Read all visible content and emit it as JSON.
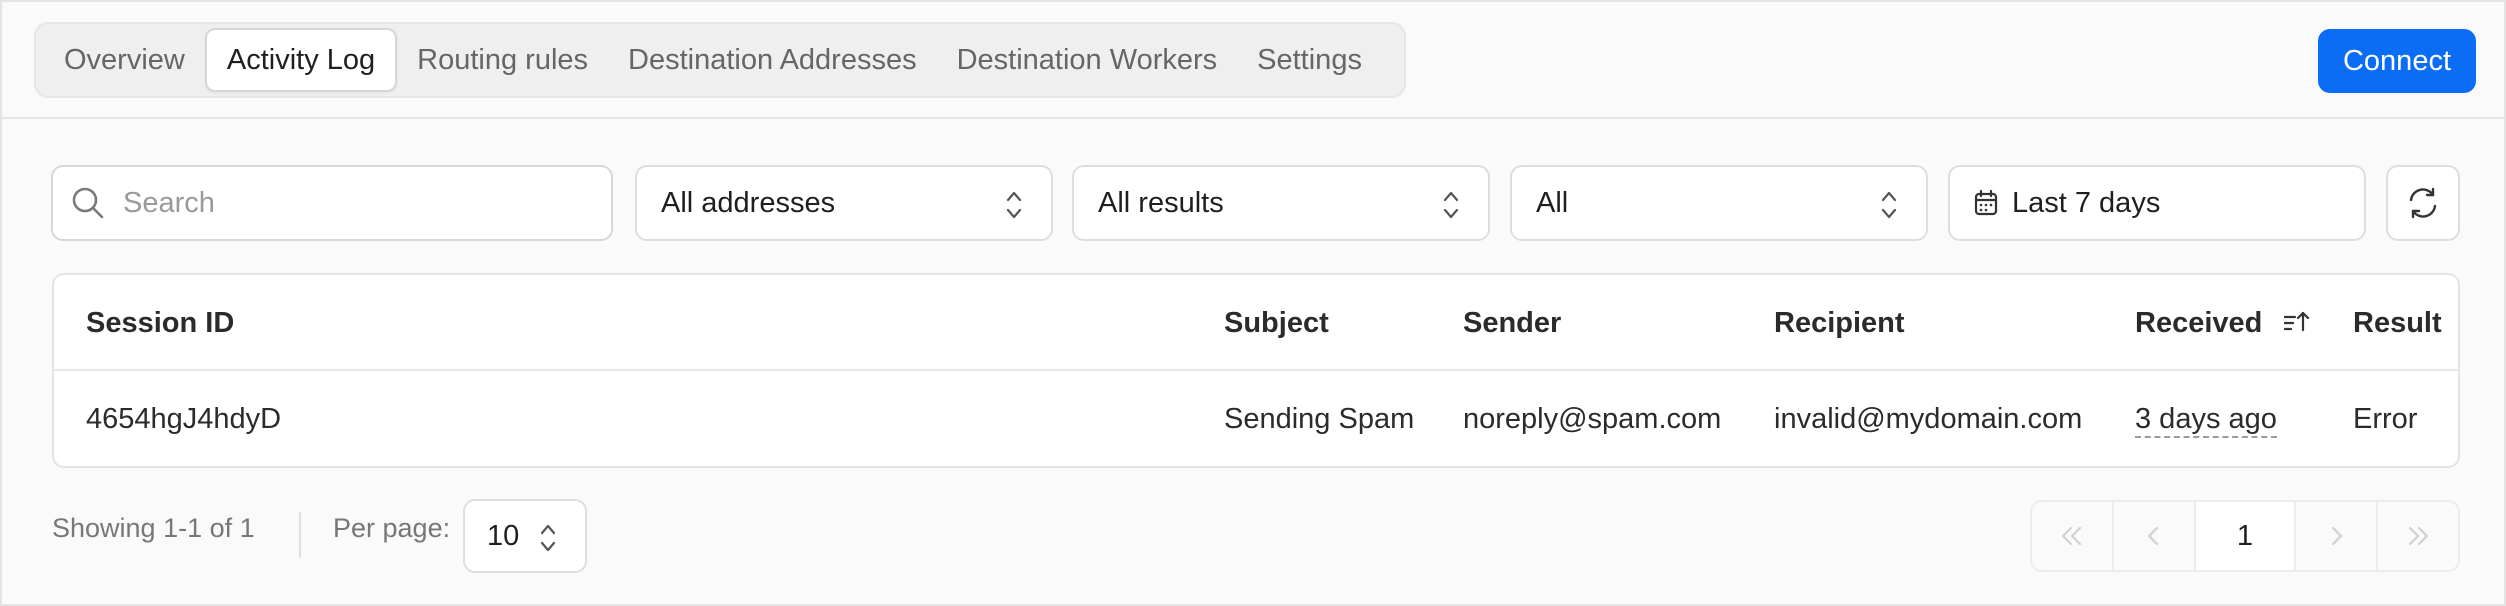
{
  "tabs": [
    {
      "label": "Overview"
    },
    {
      "label": "Activity Log"
    },
    {
      "label": "Routing rules"
    },
    {
      "label": "Destination Addresses"
    },
    {
      "label": "Destination Workers"
    },
    {
      "label": "Settings"
    }
  ],
  "active_tab": "Activity Log",
  "connect_label": "Connect",
  "filters": {
    "search_placeholder": "Search",
    "search_value": "",
    "addresses": "All addresses",
    "results": "All results",
    "type": "All",
    "date_range": "Last 7 days"
  },
  "table": {
    "columns": [
      "Session ID",
      "Subject",
      "Sender",
      "Recipient",
      "Received",
      "Result"
    ],
    "rows": [
      {
        "session_id": "4654hgJ4hdyD",
        "subject": "Sending Spam",
        "sender": "noreply@spam.com",
        "recipient": "invalid@mydomain.com",
        "received": "3 days ago",
        "result": "Error"
      }
    ]
  },
  "footer": {
    "showing": "Showing 1-1 of 1",
    "per_page_label": "Per page:",
    "per_page_value": "10",
    "current_page": "1"
  },
  "colors": {
    "accent": "#0b6cf5",
    "link": "#1a73e8"
  },
  "icons": {
    "search": "search-icon",
    "chevrons": "chevron-up-down-icon",
    "calendar": "calendar-icon",
    "refresh": "refresh-icon",
    "sort": "sort-ascending-icon",
    "first": "double-chevron-left-icon",
    "prev": "chevron-left-icon",
    "next": "chevron-right-icon",
    "last": "double-chevron-right-icon"
  }
}
